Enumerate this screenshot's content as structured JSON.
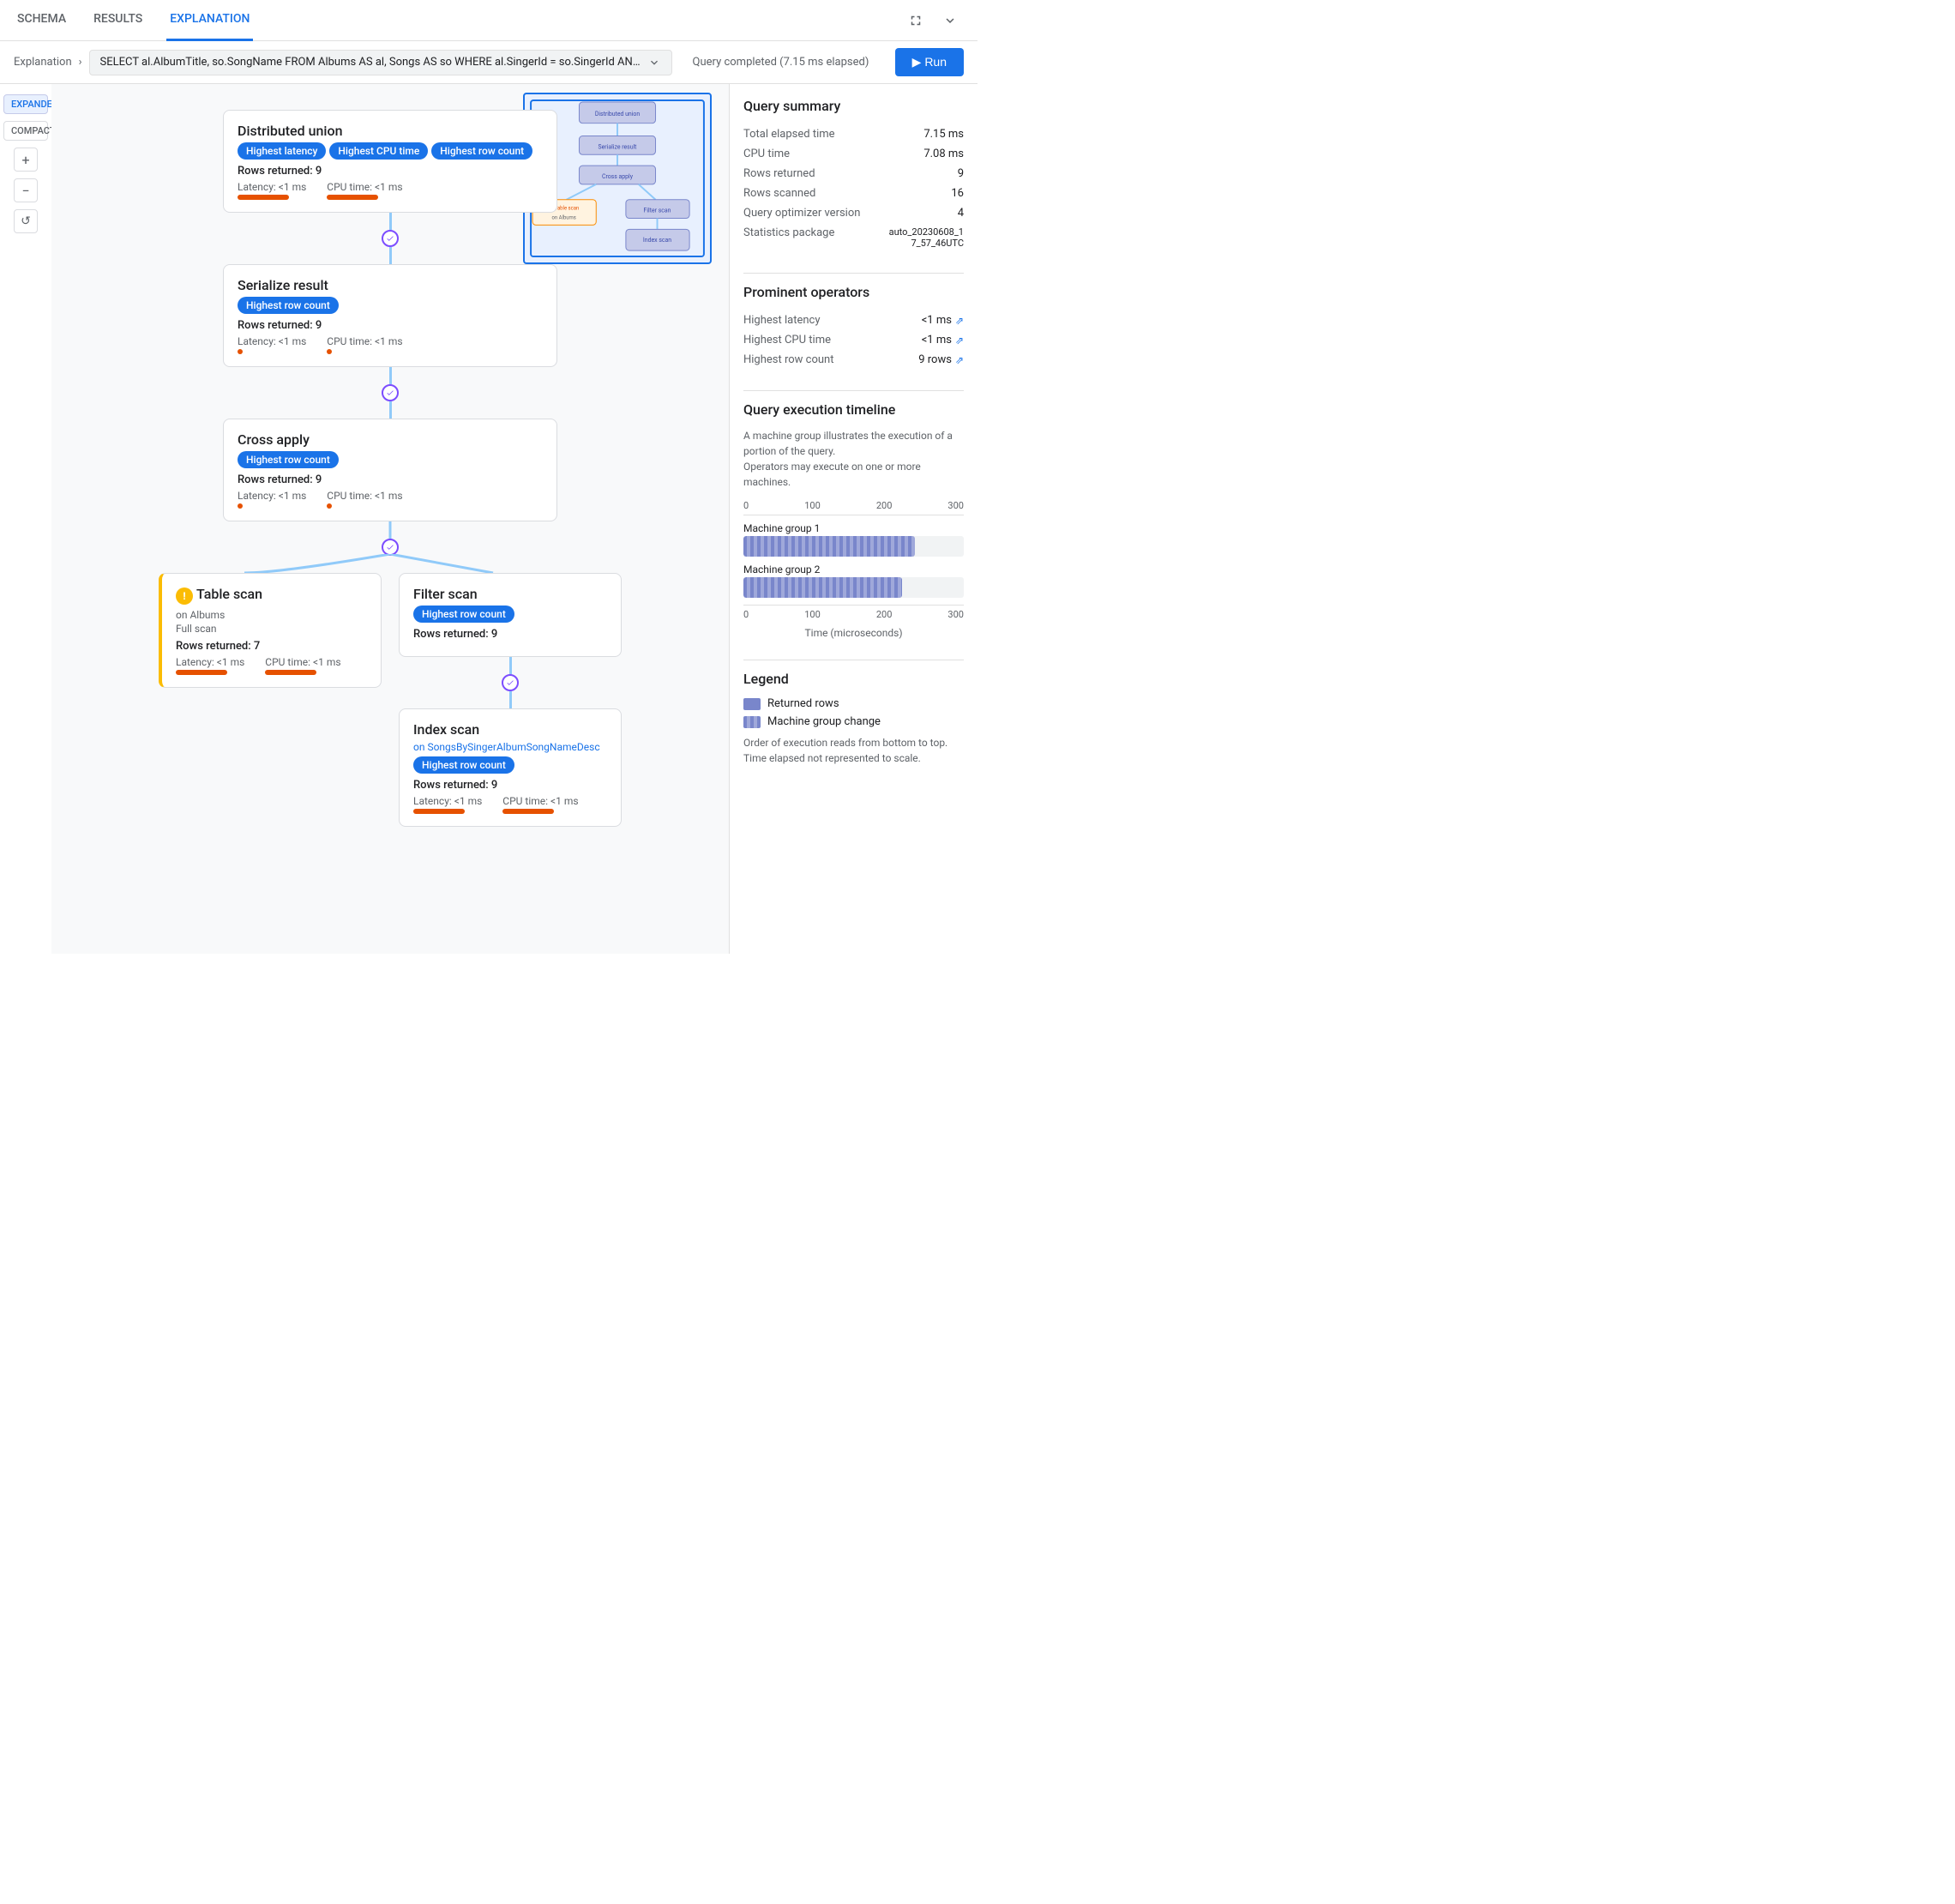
{
  "tabs": {
    "items": [
      {
        "label": "SCHEMA",
        "active": false
      },
      {
        "label": "RESULTS",
        "active": false
      },
      {
        "label": "EXPLANATION",
        "active": true
      }
    ]
  },
  "breadcrumb": {
    "label": "Explanation",
    "query": "SELECT al.AlbumTitle, so.SongName FROM Albums AS al, Songs AS so WHERE al.SingerId = so.SingerId AND al.AlbumId = so.Alb...",
    "status": "Query completed (7.15 ms elapsed)"
  },
  "controls": {
    "expanded_label": "EXPANDED",
    "compact_label": "COMPACT",
    "zoom_in": "+",
    "zoom_out": "−"
  },
  "nodes": {
    "distributed_union": {
      "title": "Distributed union",
      "badges": [
        "Highest latency",
        "Highest CPU time",
        "Highest row count"
      ],
      "rows": "Rows returned: 9",
      "latency": "Latency: <1 ms",
      "cpu_time": "CPU time: <1 ms"
    },
    "serialize_result": {
      "title": "Serialize result",
      "badges": [
        "Highest row count"
      ],
      "rows": "Rows returned: 9",
      "latency": "Latency: <1 ms",
      "cpu_time": "CPU time: <1 ms"
    },
    "cross_apply": {
      "title": "Cross apply",
      "badges": [
        "Highest row count"
      ],
      "rows": "Rows returned: 9",
      "latency": "Latency: <1 ms",
      "cpu_time": "CPU time: <1 ms"
    },
    "table_scan": {
      "title": "Table scan",
      "subtitle1": "on Albums",
      "subtitle2": "Full scan",
      "rows": "Rows returned: 7",
      "latency": "Latency: <1 ms",
      "cpu_time": "CPU time: <1 ms",
      "has_warning": true
    },
    "filter_scan": {
      "title": "Filter scan",
      "badges": [
        "Highest row count"
      ],
      "rows": "Rows returned: 9",
      "latency": "",
      "cpu_time": ""
    },
    "index_scan": {
      "title": "Index scan",
      "subtitle1": "on SongsBySingerAlbumSongNameDesc",
      "badges": [
        "Highest row count"
      ],
      "rows": "Rows returned: 9",
      "latency": "Latency: <1 ms",
      "cpu_time": "CPU time: <1 ms"
    }
  },
  "query_summary": {
    "title": "Query summary",
    "rows": [
      {
        "key": "Total elapsed time",
        "val": "7.15 ms"
      },
      {
        "key": "CPU time",
        "val": "7.08 ms"
      },
      {
        "key": "Rows returned",
        "val": "9"
      },
      {
        "key": "Rows scanned",
        "val": "16"
      },
      {
        "key": "Query optimizer version",
        "val": "4"
      },
      {
        "key": "Statistics package",
        "val": "auto_20230608_17_57_46UTC"
      }
    ]
  },
  "prominent_operators": {
    "title": "Prominent operators",
    "rows": [
      {
        "key": "Highest latency",
        "val": "<1 ms"
      },
      {
        "key": "Highest CPU time",
        "val": "<1 ms"
      },
      {
        "key": "Highest row count",
        "val": "9 rows"
      }
    ]
  },
  "execution_timeline": {
    "title": "Query execution timeline",
    "desc": "A machine group illustrates the execution of a portion of the query.\nOperators may execute on one or more machines.",
    "axis_start": "0",
    "axis_100": "100",
    "axis_200": "200",
    "axis_300": "300",
    "bars": [
      {
        "label": "Machine group 1",
        "width_pct": 78
      },
      {
        "label": "Machine group 2",
        "width_pct": 72
      }
    ],
    "x_label": "Time (microseconds)"
  },
  "legend": {
    "title": "Legend",
    "items": [
      {
        "type": "solid",
        "label": "Returned rows"
      },
      {
        "type": "striped",
        "label": "Machine group change"
      }
    ],
    "note": "Order of execution reads from bottom to top.\nTime elapsed not represented to scale."
  }
}
